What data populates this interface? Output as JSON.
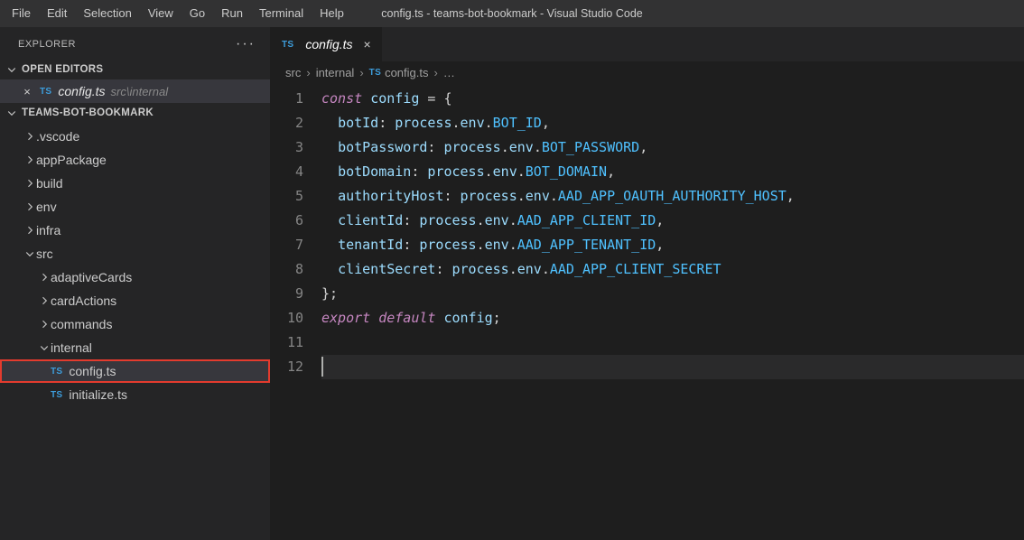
{
  "menu": [
    "File",
    "Edit",
    "Selection",
    "View",
    "Go",
    "Run",
    "Terminal",
    "Help"
  ],
  "window_title": "config.ts - teams-bot-bookmark - Visual Studio Code",
  "explorer": {
    "title": "EXPLORER",
    "open_editors_label": "OPEN EDITORS",
    "open_editor": {
      "icon": "TS",
      "name": "config.ts",
      "path": "src\\internal"
    },
    "workspace_label": "TEAMS-BOT-BOOKMARK",
    "tree": [
      {
        "label": ".vscode",
        "type": "folder",
        "indent": 1,
        "expanded": false
      },
      {
        "label": "appPackage",
        "type": "folder",
        "indent": 1,
        "expanded": false
      },
      {
        "label": "build",
        "type": "folder",
        "indent": 1,
        "expanded": false
      },
      {
        "label": "env",
        "type": "folder",
        "indent": 1,
        "expanded": false
      },
      {
        "label": "infra",
        "type": "folder",
        "indent": 1,
        "expanded": false
      },
      {
        "label": "src",
        "type": "folder",
        "indent": 1,
        "expanded": true
      },
      {
        "label": "adaptiveCards",
        "type": "folder",
        "indent": 2,
        "expanded": false
      },
      {
        "label": "cardActions",
        "type": "folder",
        "indent": 2,
        "expanded": false
      },
      {
        "label": "commands",
        "type": "folder",
        "indent": 2,
        "expanded": false
      },
      {
        "label": "internal",
        "type": "folder",
        "indent": 2,
        "expanded": true
      },
      {
        "label": "config.ts",
        "type": "file",
        "indent": 2,
        "active": true,
        "highlighted": true,
        "icon": "TS"
      },
      {
        "label": "initialize.ts",
        "type": "file",
        "indent": 2,
        "icon": "TS"
      }
    ]
  },
  "tab": {
    "icon": "TS",
    "name": "config.ts"
  },
  "breadcrumb": {
    "parts": [
      "src",
      "internal"
    ],
    "file_icon": "TS",
    "file": "config.ts",
    "tail_sep": "…"
  },
  "code": {
    "lines": [
      [
        [
          "const",
          "keyword-ctrl"
        ],
        [
          " ",
          "punc"
        ],
        [
          "config",
          "var"
        ],
        [
          " = {",
          "punc"
        ]
      ],
      [
        [
          "  ",
          "punc"
        ],
        [
          "botId",
          "prop"
        ],
        [
          ": ",
          "punc"
        ],
        [
          "process",
          "obj"
        ],
        [
          ".",
          "punc"
        ],
        [
          "env",
          "obj"
        ],
        [
          ".",
          "punc"
        ],
        [
          "BOT_ID",
          "member"
        ],
        [
          ",",
          "punc"
        ]
      ],
      [
        [
          "  ",
          "punc"
        ],
        [
          "botPassword",
          "prop"
        ],
        [
          ": ",
          "punc"
        ],
        [
          "process",
          "obj"
        ],
        [
          ".",
          "punc"
        ],
        [
          "env",
          "obj"
        ],
        [
          ".",
          "punc"
        ],
        [
          "BOT_PASSWORD",
          "member"
        ],
        [
          ",",
          "punc"
        ]
      ],
      [
        [
          "  ",
          "punc"
        ],
        [
          "botDomain",
          "prop"
        ],
        [
          ": ",
          "punc"
        ],
        [
          "process",
          "obj"
        ],
        [
          ".",
          "punc"
        ],
        [
          "env",
          "obj"
        ],
        [
          ".",
          "punc"
        ],
        [
          "BOT_DOMAIN",
          "member"
        ],
        [
          ",",
          "punc"
        ]
      ],
      [
        [
          "  ",
          "punc"
        ],
        [
          "authorityHost",
          "prop"
        ],
        [
          ": ",
          "punc"
        ],
        [
          "process",
          "obj"
        ],
        [
          ".",
          "punc"
        ],
        [
          "env",
          "obj"
        ],
        [
          ".",
          "punc"
        ],
        [
          "AAD_APP_OAUTH_AUTHORITY_HOST",
          "member"
        ],
        [
          ",",
          "punc"
        ]
      ],
      [
        [
          "  ",
          "punc"
        ],
        [
          "clientId",
          "prop"
        ],
        [
          ": ",
          "punc"
        ],
        [
          "process",
          "obj"
        ],
        [
          ".",
          "punc"
        ],
        [
          "env",
          "obj"
        ],
        [
          ".",
          "punc"
        ],
        [
          "AAD_APP_CLIENT_ID",
          "member"
        ],
        [
          ",",
          "punc"
        ]
      ],
      [
        [
          "  ",
          "punc"
        ],
        [
          "tenantId",
          "prop"
        ],
        [
          ": ",
          "punc"
        ],
        [
          "process",
          "obj"
        ],
        [
          ".",
          "punc"
        ],
        [
          "env",
          "obj"
        ],
        [
          ".",
          "punc"
        ],
        [
          "AAD_APP_TENANT_ID",
          "member"
        ],
        [
          ",",
          "punc"
        ]
      ],
      [
        [
          "  ",
          "punc"
        ],
        [
          "clientSecret",
          "prop"
        ],
        [
          ": ",
          "punc"
        ],
        [
          "process",
          "obj"
        ],
        [
          ".",
          "punc"
        ],
        [
          "env",
          "obj"
        ],
        [
          ".",
          "punc"
        ],
        [
          "AAD_APP_CLIENT_SECRET",
          "member"
        ]
      ],
      [
        [
          "};",
          "punc"
        ]
      ],
      [
        [
          "",
          "punc"
        ]
      ],
      [
        [
          "export",
          "keyword-ctrl"
        ],
        [
          " ",
          "punc"
        ],
        [
          "default",
          "keyword-ctrl"
        ],
        [
          " ",
          "punc"
        ],
        [
          "config",
          "var"
        ],
        [
          ";",
          "punc"
        ]
      ],
      [
        [
          "",
          "punc"
        ]
      ]
    ]
  }
}
